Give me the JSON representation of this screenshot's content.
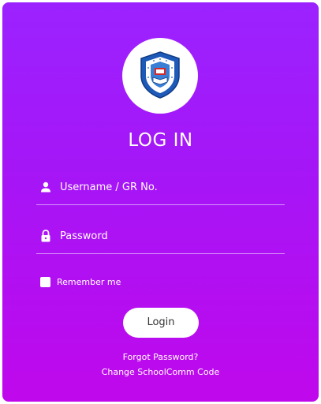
{
  "login": {
    "title": "LOG IN",
    "username_placeholder": "Username / GR No.",
    "password_placeholder": "Password",
    "remember_label": "Remember me",
    "login_button": "Login",
    "forgot_password": "Forgot Password?",
    "change_code": "Change SchoolComm Code"
  },
  "icons": {
    "user": "user-icon",
    "lock": "lock-icon",
    "logo": "school-crest-logo"
  },
  "colors": {
    "gradient_top": "#9b22ff",
    "gradient_bottom": "#c008ec",
    "text": "#ffffff",
    "button_bg": "#ffffff"
  }
}
